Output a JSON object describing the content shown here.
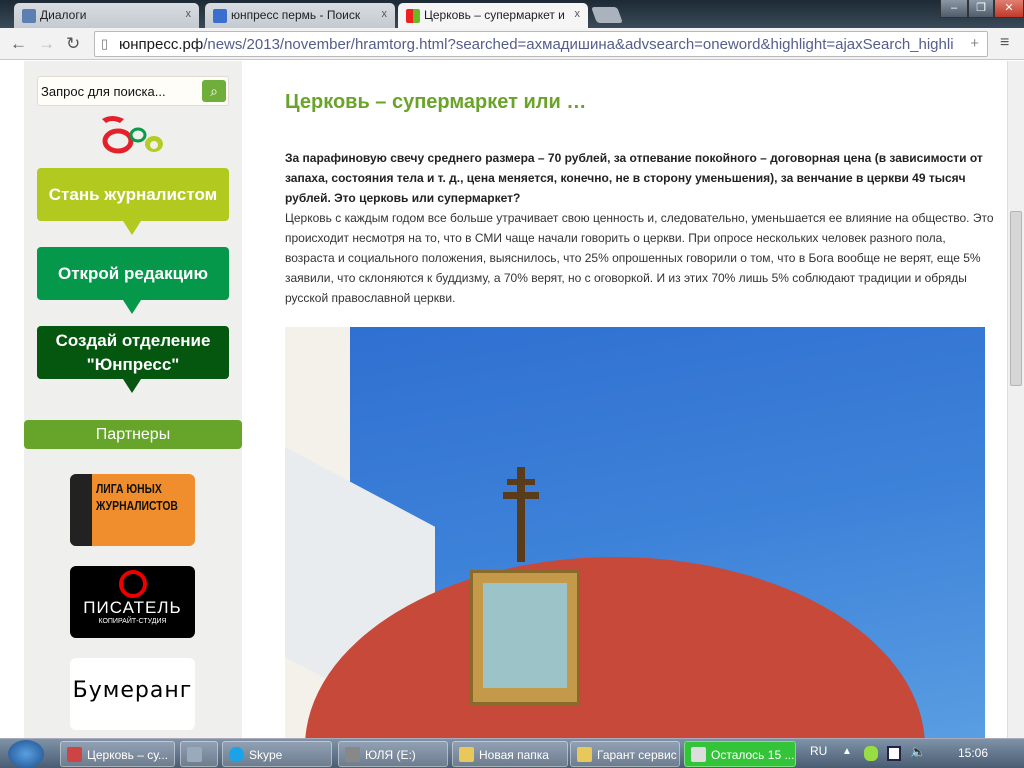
{
  "browser": {
    "tabs": [
      {
        "label": "Диалоги",
        "active": false
      },
      {
        "label": "юнпресс пермь - Поиск",
        "active": false
      },
      {
        "label": "Церковь – супермаркет и",
        "active": true
      }
    ],
    "close_glyph": "x",
    "url_host": "юнпресс.рф",
    "url_path": "/news/2013/november/hramtorg.html?searched=ахмадишина&advsearch=oneword&highlight=ajaxSearch_highli",
    "add_glyph": "+"
  },
  "sidebar": {
    "search_placeholder": "Запрос для поиска...",
    "cta": [
      "Стань журналистом",
      "Открой редакцию",
      "Создай отделение \"Юнпресс\""
    ],
    "partners_label": "Партнеры",
    "partners": [
      {
        "name": "ЛИГА ЮНЫХ ЖУРНАЛИСТОВ"
      },
      {
        "name": "ПИСАТЕЛЬ",
        "sub": "КОПИРАЙТ-СТУДИЯ"
      },
      {
        "name": "Бумеранг"
      }
    ]
  },
  "article": {
    "title": "Церковь – супермаркет или …",
    "lead": "За парафиновую свечу среднего размера – 70 рублей, за отпевание покойного – договорная цена (в зависимости от запаха, состояния тела и т. д., цена меняется, конечно, не в сторону уменьшения), за венчание в церкви 49 тысяч рублей. Это церковь или супермаркет?",
    "body": "Церковь с каждым годом все больше утрачивает свою ценность и, следовательно, уменьшается ее влияние на общество. Это происходит несмотря на то, что в СМИ чаще начали говорить о церкви. При опросе  нескольких человек разного пола, возраста и социального положения, выяснилось, что 25% опрошенных говорили о том, что в Бога вообще не верят, еще 5% заявили, что склоняются к буддизму, а 70% верят, но с оговоркой. И из этих 70% лишь 5% соблюдают традиции и обряды русской православной церкви."
  },
  "taskbar": {
    "items": [
      "Церковь – су...",
      "Skype",
      "ЮЛЯ (E:)",
      "Новая папка",
      "Гарант сервис",
      "Осталось 15 ..."
    ],
    "lang": "RU",
    "time": "15:06"
  }
}
